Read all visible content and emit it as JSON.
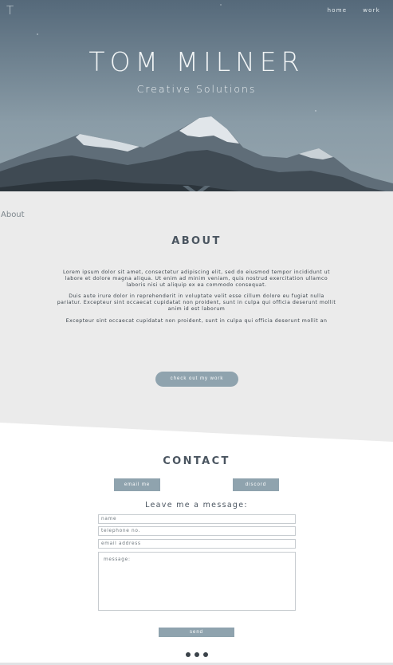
{
  "logo": "T",
  "nav": {
    "home": "home",
    "work": "work"
  },
  "hero": {
    "title": "TOM MILNER",
    "subtitle": "Creative Solutions"
  },
  "about": {
    "link": "About",
    "title": "ABOUT",
    "paragraphs": [
      "Lorem ipsum dolor sit amet, consectetur adipiscing elit, sed do eiusmod tempor incididunt ut labore et dolore magna aliqua. Ut enim ad minim veniam, quis nostrud exercitation ullamco laboris nisi ut aliquip ex ea commodo consequat.",
      "Duis aute irure dolor in reprehenderit in voluptate velit esse cillum dolore eu fugiat nulla pariatur. Excepteur sint occaecat cupidatat non proident, sunt in culpa qui officia deserunt mollit anim id est laborum",
      "Excepteur sint occaecat cupidatat non proident, sunt in culpa qui officia deserunt mollit an"
    ],
    "button": "check out my work"
  },
  "contact": {
    "title": "CONTACT",
    "email_button": "email me",
    "discord_button": "discord",
    "leave_message": "Leave me a message:",
    "placeholders": {
      "name": "name",
      "telephone": "telephone no.",
      "email": "email address",
      "message": "message:"
    },
    "send_button": "send"
  },
  "colors": {
    "accent": "#8fa3ae",
    "section_bg": "#ebebeb",
    "heading": "#4a5560"
  }
}
